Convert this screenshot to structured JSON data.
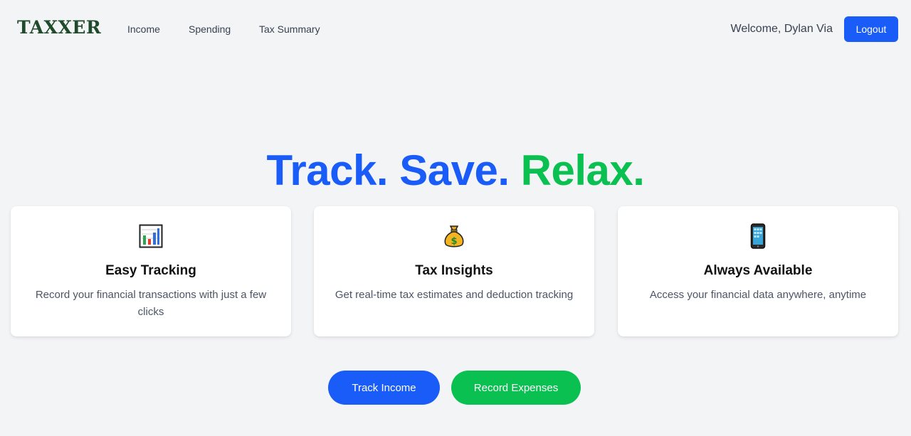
{
  "brand": {
    "logo_text": "TAXXER",
    "logo_color": "#1f4a2c"
  },
  "nav": {
    "links": [
      {
        "label": "Income"
      },
      {
        "label": "Spending"
      },
      {
        "label": "Tax Summary"
      }
    ],
    "welcome_text": "Welcome, Dylan Via",
    "logout_label": "Logout"
  },
  "hero": {
    "word1": "Track.",
    "word2": "Save.",
    "word3": "Relax.",
    "blue": "#1a5cf7",
    "green": "#0ac050"
  },
  "features": [
    {
      "icon": "bar-chart-icon",
      "title": "Easy Tracking",
      "description": "Record your financial transactions with just a few clicks"
    },
    {
      "icon": "money-bag-icon",
      "title": "Tax Insights",
      "description": "Get real-time tax estimates and deduction tracking"
    },
    {
      "icon": "mobile-phone-icon",
      "title": "Always Available",
      "description": "Access your financial data anywhere, anytime"
    }
  ],
  "actions": {
    "track_income_label": "Track Income",
    "record_expenses_label": "Record Expenses"
  }
}
